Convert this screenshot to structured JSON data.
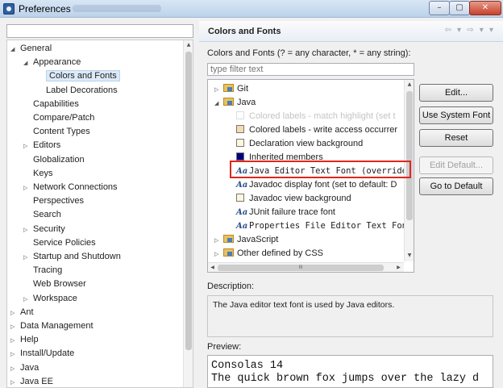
{
  "window": {
    "title": "Preferences",
    "controls": {
      "minimize": "–",
      "maximize": "▢",
      "close": "✕"
    }
  },
  "left_tree": {
    "filter_value": "",
    "items": [
      {
        "label": "General",
        "depth": 0,
        "expanded": true
      },
      {
        "label": "Appearance",
        "depth": 1,
        "expanded": true
      },
      {
        "label": "Colors and Fonts",
        "depth": 2,
        "selected": true
      },
      {
        "label": "Label Decorations",
        "depth": 2
      },
      {
        "label": "Capabilities",
        "depth": 1
      },
      {
        "label": "Compare/Patch",
        "depth": 1
      },
      {
        "label": "Content Types",
        "depth": 1
      },
      {
        "label": "Editors",
        "depth": 1,
        "collapsed": true
      },
      {
        "label": "Globalization",
        "depth": 1
      },
      {
        "label": "Keys",
        "depth": 1
      },
      {
        "label": "Network Connections",
        "depth": 1,
        "collapsed": true
      },
      {
        "label": "Perspectives",
        "depth": 1
      },
      {
        "label": "Search",
        "depth": 1
      },
      {
        "label": "Security",
        "depth": 1,
        "collapsed": true
      },
      {
        "label": "Service Policies",
        "depth": 1
      },
      {
        "label": "Startup and Shutdown",
        "depth": 1,
        "collapsed": true
      },
      {
        "label": "Tracing",
        "depth": 1
      },
      {
        "label": "Web Browser",
        "depth": 1
      },
      {
        "label": "Workspace",
        "depth": 1,
        "collapsed": true
      },
      {
        "label": "Ant",
        "depth": 0,
        "collapsed": true
      },
      {
        "label": "Data Management",
        "depth": 0,
        "collapsed": true
      },
      {
        "label": "Help",
        "depth": 0,
        "collapsed": true
      },
      {
        "label": "Install/Update",
        "depth": 0,
        "collapsed": true
      },
      {
        "label": "Java",
        "depth": 0,
        "collapsed": true
      },
      {
        "label": "Java EE",
        "depth": 0,
        "collapsed": true
      }
    ]
  },
  "page": {
    "title": "Colors and Fonts",
    "nav_back": "⇦ ▾",
    "nav_forward": "⇨ ▾",
    "nav_menu": "▾",
    "filter_label": "Colors and Fonts (? = any character, * = any string):",
    "filter_placeholder": "type filter text",
    "tree": [
      {
        "label": "Git",
        "kind": "folder",
        "depth": 0,
        "collapsed": true
      },
      {
        "label": "Java",
        "kind": "folder",
        "depth": 0,
        "expanded": true
      },
      {
        "label": "Colored labels - match highlight (set t",
        "kind": "color",
        "swatch": "#ffffff",
        "depth": 1,
        "faded": true
      },
      {
        "label": "Colored labels - write access occurrer",
        "kind": "color",
        "swatch": "#f3dcae",
        "depth": 1
      },
      {
        "label": "Declaration view background",
        "kind": "color",
        "swatch": "#fff6dc",
        "depth": 1
      },
      {
        "label": "Inherited members",
        "kind": "color",
        "swatch": "#000080",
        "depth": 1
      },
      {
        "label": "Java Editor Text Font (overrides",
        "kind": "font",
        "depth": 1,
        "mono": true,
        "highlighted": true
      },
      {
        "label": "Javadoc display font (set to default: D",
        "kind": "font",
        "depth": 1
      },
      {
        "label": "Javadoc view background",
        "kind": "color",
        "swatch": "#fff6dc",
        "depth": 1
      },
      {
        "label": "JUnit failure trace font",
        "kind": "font",
        "depth": 1
      },
      {
        "label": "Properties File Editor Text Font",
        "kind": "font",
        "depth": 1,
        "mono": true
      },
      {
        "label": "JavaScript",
        "kind": "folder",
        "depth": 0,
        "collapsed": true
      },
      {
        "label": "Other defined by CSS",
        "kind": "folder",
        "depth": 0,
        "collapsed": true
      }
    ],
    "hscroll_grip": "III",
    "buttons": {
      "edit": "Edit...",
      "use_system_font": "Use System Font",
      "reset": "Reset",
      "edit_default": "Edit Default...",
      "go_to_default": "Go to Default"
    },
    "description_label": "Description:",
    "description_text": "The Java editor text font is used by Java editors.",
    "preview_label": "Preview:",
    "preview_lines": [
      "Consolas 14",
      "The quick brown fox jumps over the lazy d"
    ]
  },
  "colors": {
    "highlight_border": "#e1261c",
    "selection": "#dceaf9"
  }
}
